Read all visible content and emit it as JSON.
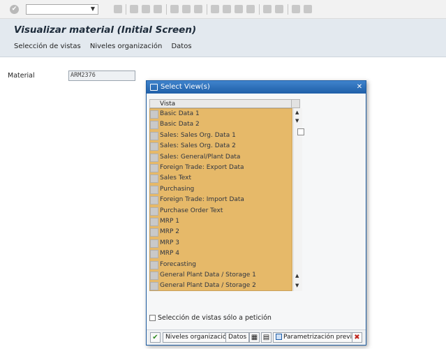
{
  "screen": {
    "title": "Visualizar material (Initial Screen)",
    "menu": [
      "Selección de vistas",
      "Niveles organización",
      "Datos"
    ]
  },
  "material": {
    "label": "Material",
    "value": "ARM2376"
  },
  "dialog": {
    "title": "Select View(s)",
    "column_header": "Vista",
    "views": [
      "Basic Data 1",
      "Basic Data 2",
      "Sales: Sales Org. Data 1",
      "Sales: Sales Org. Data 2",
      "Sales: General/Plant Data",
      "Foreign Trade: Export Data",
      "Sales Text",
      "Purchasing",
      "Foreign Trade: Import Data",
      "Purchase Order Text",
      "MRP 1",
      "MRP 2",
      "MRP 3",
      "MRP 4",
      "Forecasting",
      "General Plant Data / Storage 1",
      "General Plant Data / Storage 2"
    ],
    "on_demand_label": "Selección de vistas sólo a petición",
    "buttons": {
      "org_levels": "Niveles organización",
      "data": "Datos",
      "default_values": "Parametrización previa"
    }
  },
  "icons": {
    "confirm": "green-check-icon",
    "cancel": "red-cancel-icon",
    "save": "save-icon"
  },
  "colors": {
    "selection_highlight": "#e6b969",
    "title_bar": "#1f5fa8"
  }
}
